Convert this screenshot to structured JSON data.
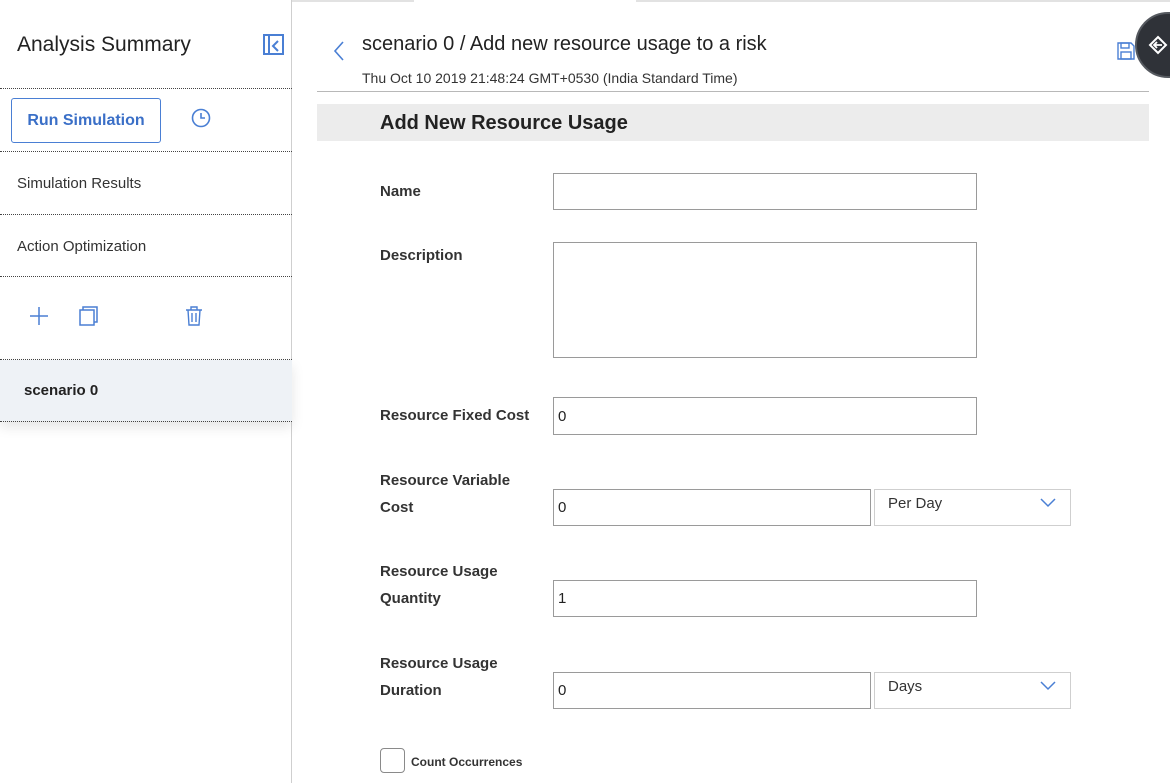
{
  "sidebar": {
    "title": "Analysis Summary",
    "run_button": "Run Simulation",
    "items": [
      {
        "label": "Simulation Results"
      },
      {
        "label": "Action Optimization"
      }
    ],
    "scenario": "scenario 0"
  },
  "header": {
    "title": "scenario 0 / Add new resource usage to a risk",
    "timestamp": "Thu Oct 10 2019 21:48:24 GMT+0530 (India Standard Time)"
  },
  "form": {
    "section_title": "Add New Resource Usage",
    "name": {
      "label": "Name",
      "value": ""
    },
    "description": {
      "label": "Description",
      "value": ""
    },
    "fixed_cost": {
      "label": "Resource Fixed Cost",
      "value": "0"
    },
    "variable_cost": {
      "label_line1": "Resource Variable",
      "label_line2": "Cost",
      "value": "0",
      "unit": "Per Day"
    },
    "usage_quantity": {
      "label_line1": "Resource Usage",
      "label_line2": "Quantity",
      "value": "1"
    },
    "usage_duration": {
      "label_line1": "Resource Usage",
      "label_line2": "Duration",
      "value": "0",
      "unit": "Days"
    },
    "count_occurrences": {
      "label": "Count Occurrences",
      "checked": false
    }
  },
  "colors": {
    "accent": "#4a7fd4",
    "section_band": "#ececec",
    "selected_row": "#eef2f6",
    "fab": "#2f3238"
  },
  "icons": [
    "collapse-panel-icon",
    "history-icon",
    "plus-icon",
    "copy-icon",
    "trash-icon",
    "back-chevron-icon",
    "save-icon",
    "chevron-down-icon",
    "exit-icon"
  ]
}
